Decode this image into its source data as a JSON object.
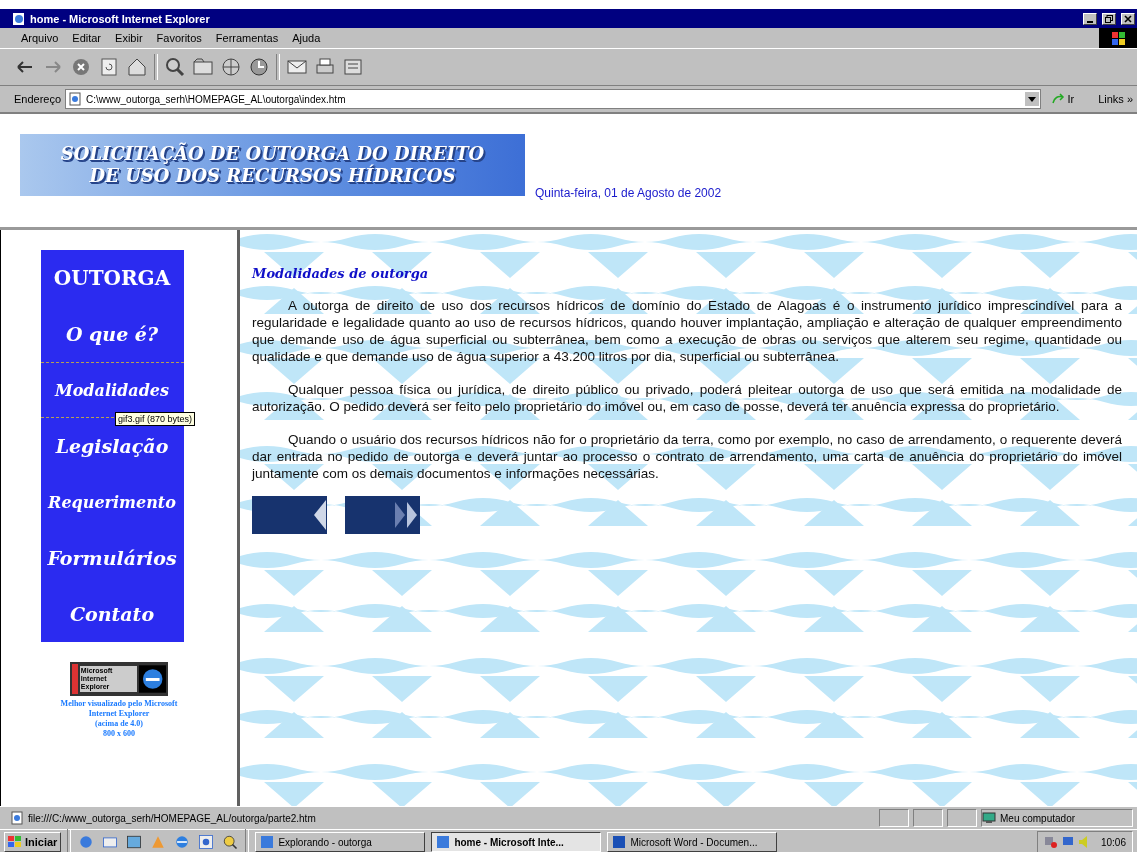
{
  "window": {
    "title": "home - Microsoft Internet Explorer"
  },
  "menu": [
    "Arquivo",
    "Editar",
    "Exibir",
    "Favoritos",
    "Ferramentas",
    "Ajuda"
  ],
  "address_bar": {
    "label": "Endereço",
    "value": "C:\\www_outorga_serh\\HOMEPAGE_AL\\outorga\\index.htm",
    "go": "Ir",
    "links": "Links »"
  },
  "header": {
    "banner": [
      "SOLICITAÇÃO DE OUTORGA DO DIREITO",
      "DE USO DOS RECURSOS HÍDRICOS"
    ],
    "date": "Quinta-feira, 01 de Agosto de 2002"
  },
  "sidebar": {
    "heading": "OUTORGA",
    "items": [
      {
        "label": "O que é?",
        "selected": false
      },
      {
        "label": "Modalidades",
        "selected": true
      },
      {
        "label": "Legislação",
        "selected": false
      },
      {
        "label": "Requerimento",
        "selected": false
      },
      {
        "label": "Formulários",
        "selected": false
      },
      {
        "label": "Contato",
        "selected": false
      }
    ],
    "tooltip": "gif3.gif (870 bytes)",
    "badge": "Microsoft Internet Explorer",
    "note": [
      "Melhor visualizado pelo Microsoft",
      "Internet Explorer",
      "(acima de 4.0)",
      "800 x 600"
    ]
  },
  "content": {
    "title": "Modalidades de outorga",
    "paragraphs": [
      "A outorga de direito de uso dos recursos hídricos de domínio do Estado de Alagoas é o instrumento jurídico imprescindível para a regularidade e legalidade quanto ao uso de recursos hídricos, quando houver implantação, ampliação e alteração de qualquer empreendimento que demande uso de água superficial ou subterrânea, bem como a execução de obras ou serviços que alterem seu regime, quantidade ou qualidade e que demande uso de água superior a 43.200 litros por dia, superficial ou subterrânea.",
      "Qualquer pessoa física ou jurídica, de direito público ou privado, poderá pleitear outorga de uso que será emitida na modalidade de autorização. O pedido deverá ser feito pelo proprietário do imóvel ou, em caso de posse, deverá ter anuência expressa do proprietário.",
      "Quando o usuário dos recursos hídricos não for o proprietário da terra, como por exemplo, no caso de arrendamento, o requerente deverá dar entrada no pedido de outorga e deverá juntar ao processo o contrato de arrendamento, uma carta de anuência do proprietário do imóvel juntamente com os demais documentos e informações necessárias."
    ]
  },
  "status_bar": {
    "url": "file:///C:/www_outorga_serh/HOMEPAGE_AL/outorga/parte2.htm",
    "zone": "Meu computador"
  },
  "taskbar": {
    "start": "Iniciar",
    "tasks": [
      {
        "label": "Explorando - outorga",
        "selected": false
      },
      {
        "label": "home - Microsoft Inte...",
        "selected": true
      },
      {
        "label": "Microsoft Word - Documen...",
        "selected": false
      }
    ],
    "clock": "10:06"
  }
}
